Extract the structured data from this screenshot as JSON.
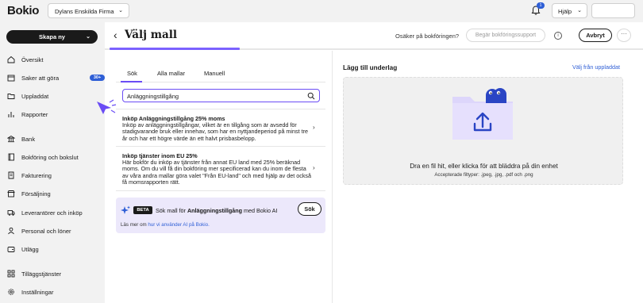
{
  "app": {
    "logo": "Bokio",
    "company": "Dylans Enskilda Firma",
    "notifications_count": "1",
    "help_label": "Hjälp"
  },
  "sidebar": {
    "create_label": "Skapa ny",
    "items": [
      {
        "label": "Översikt",
        "icon": "home-icon"
      },
      {
        "label": "Saker att göra",
        "icon": "calendar-icon",
        "badge": "30+"
      },
      {
        "label": "Uppladdat",
        "icon": "folder-icon"
      },
      {
        "label": "Rapporter",
        "icon": "chart-icon"
      },
      {
        "label": "Bank",
        "icon": "bank-icon"
      },
      {
        "label": "Bokföring och bokslut",
        "icon": "book-icon"
      },
      {
        "label": "Fakturering",
        "icon": "invoice-icon"
      },
      {
        "label": "Försäljning",
        "icon": "store-icon"
      },
      {
        "label": "Leverantörer och inköp",
        "icon": "truck-icon"
      },
      {
        "label": "Personal och löner",
        "icon": "person-icon"
      },
      {
        "label": "Utlägg",
        "icon": "wallet-icon"
      },
      {
        "label": "Tilläggstjänster",
        "icon": "grid-icon"
      },
      {
        "label": "Inställningar",
        "icon": "gear-icon"
      }
    ]
  },
  "header": {
    "title": "Välj mall",
    "unsure_text": "Osäker på bokföringen?",
    "support_button": "Begär bokföringssupport",
    "cancel_button": "Avbryt",
    "more_button": "···"
  },
  "left_panel": {
    "tabs": [
      "Sök",
      "Alla mallar",
      "Manuell"
    ],
    "active_tab": "Sök",
    "search_value": "Anläggningstillgång",
    "results": [
      {
        "title": "Inköp Anläggningstillgång 25% moms",
        "description": "Inköp av anläggningstillgångar, vilket är en tillgång som är avsedd för stadigvarande bruk eller innehav, som har en nyttjandeperiod på minst tre år och har ett högre värde än ett halvt prisbasbelopp."
      },
      {
        "title": "Inköp tjänster inom EU 25%",
        "description": "Här bokför du inköp av tjänster från annat EU land med 25% beräknad moms. Om du vill få din bokföring mer specificerad kan du inom de flesta av våra andra mallar göra valet \"Från EU-land\" och med hjälp av det också få momsrapporten rätt."
      }
    ],
    "ai": {
      "badge": "BETA",
      "text_prefix": "Sök mall för ",
      "text_term": "Anläggningstillgång",
      "text_suffix": " med Bokio AI",
      "button": "Sök",
      "learn_prefix": "Läs mer om ",
      "learn_link": "hur vi använder AI på Bokio."
    }
  },
  "right_panel": {
    "title": "Lägg till underlag",
    "link": "Välj från uppladdat",
    "drop_text": "Dra en fil hit, eller klicka för att bläddra på din enhet",
    "accepted": "Accepterade filtyper: .jpeg, .jpg, .pdf och .png"
  },
  "colors": {
    "accent": "#6a4cf5",
    "link": "#2f5fd6",
    "ai_bg": "#ece8fb",
    "folder": "#ddd6fb"
  },
  "progress": 0.25
}
